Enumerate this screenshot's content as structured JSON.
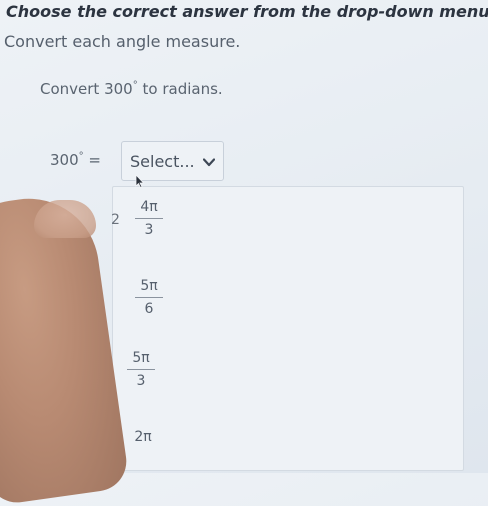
{
  "instruction": "Choose the correct answer from the drop-down menu.",
  "subtitle": "Convert each angle measure.",
  "question": {
    "prefix": "Convert",
    "value": "300",
    "degree_symbol": "°",
    "suffix": "to radians."
  },
  "equation": {
    "value": "300",
    "degree_symbol": "°",
    "equals": "="
  },
  "select": {
    "placeholder": "Select..."
  },
  "peek_text": "2",
  "options": [
    {
      "numerator": "4π",
      "denominator": "3"
    },
    {
      "numerator": "5π",
      "denominator": "6"
    },
    {
      "numerator": "5π",
      "denominator": "3"
    },
    {
      "text": "2π"
    }
  ]
}
